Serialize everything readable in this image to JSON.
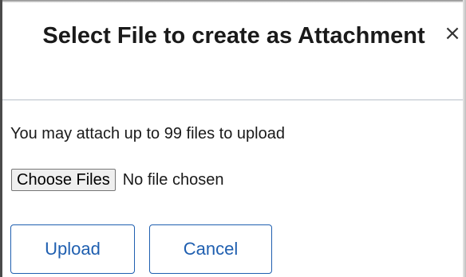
{
  "dialog": {
    "title": "Select File to create as Attachment",
    "close_icon": "close-icon",
    "close_glyph": "×",
    "info_text": "You may attach up to 99 files to upload",
    "choose_files_label": "Choose Files",
    "file_status": "No file chosen",
    "upload_label": "Upload",
    "cancel_label": "Cancel"
  },
  "colors": {
    "accent": "#1f5fb0",
    "header_divider": "#b8c0c8",
    "text": "#1a1a1a"
  }
}
